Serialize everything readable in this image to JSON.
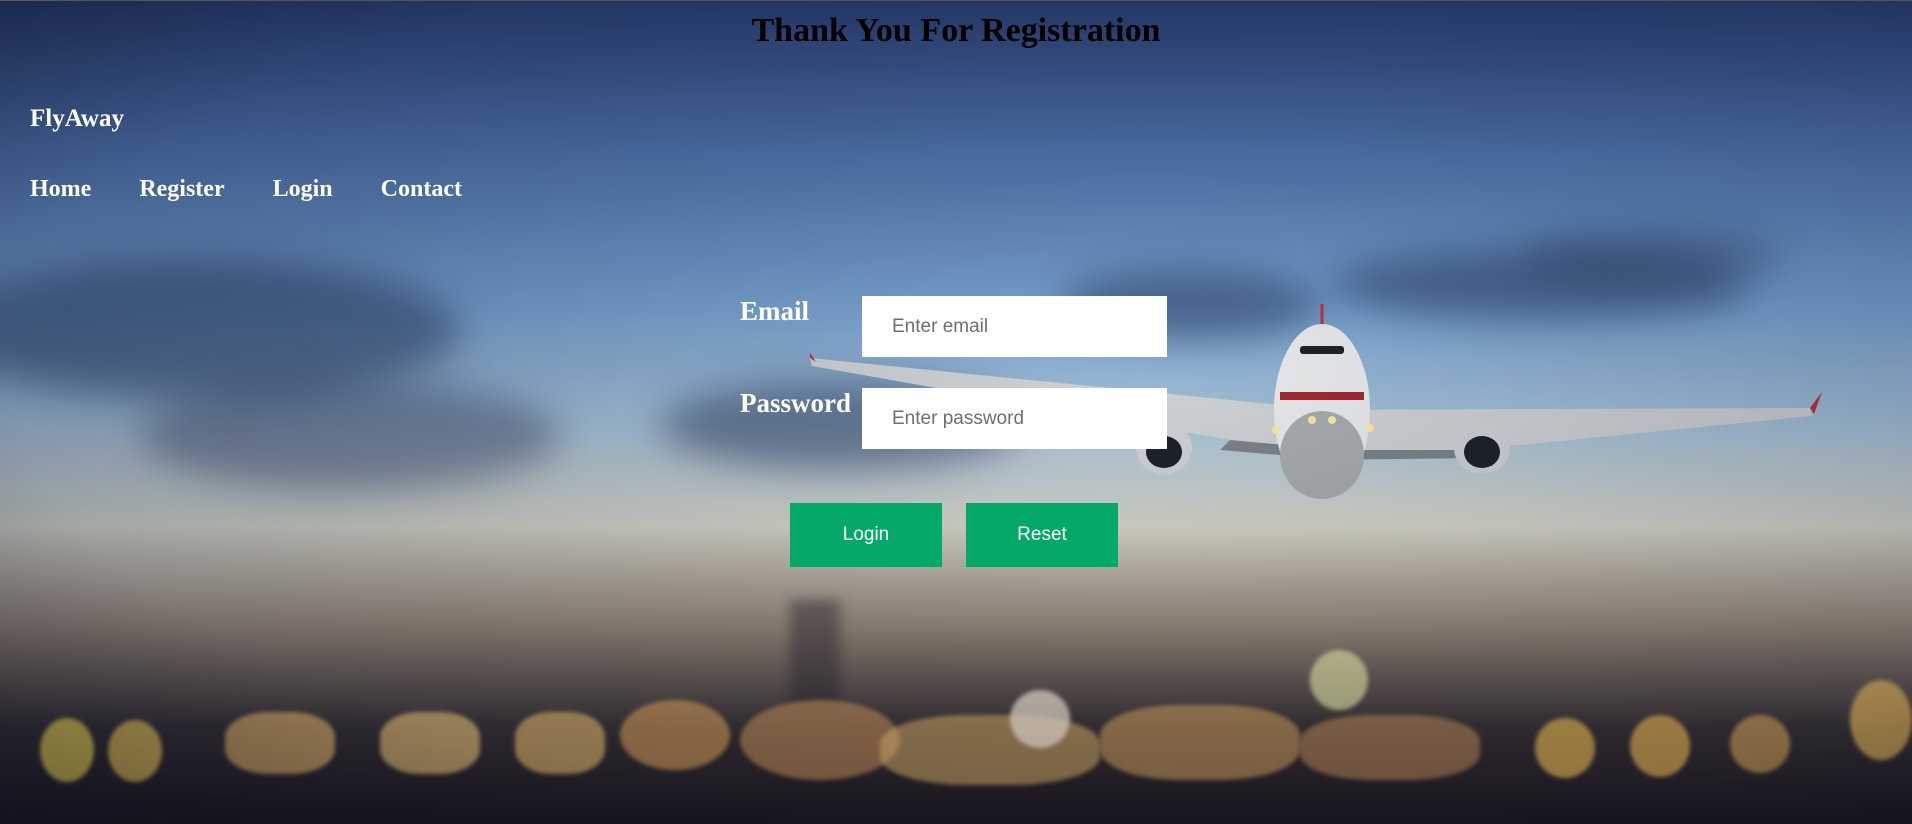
{
  "page": {
    "title": "Thank You For Registration"
  },
  "header": {
    "brand": "FlyAway",
    "nav": [
      {
        "label": "Home"
      },
      {
        "label": "Register"
      },
      {
        "label": "Login"
      },
      {
        "label": "Contact"
      }
    ]
  },
  "login_form": {
    "email_label": "Email",
    "email_placeholder": "Enter email",
    "email_value": "",
    "password_label": "Password",
    "password_placeholder": "Enter password",
    "password_value": "",
    "login_button": "Login",
    "reset_button": "Reset"
  },
  "colors": {
    "button_bg": "#04a96a",
    "title_text": "#000000",
    "nav_text": "#ffffff",
    "input_bg": "#ffffff"
  },
  "icons": {
    "background": "airplane-photo"
  }
}
